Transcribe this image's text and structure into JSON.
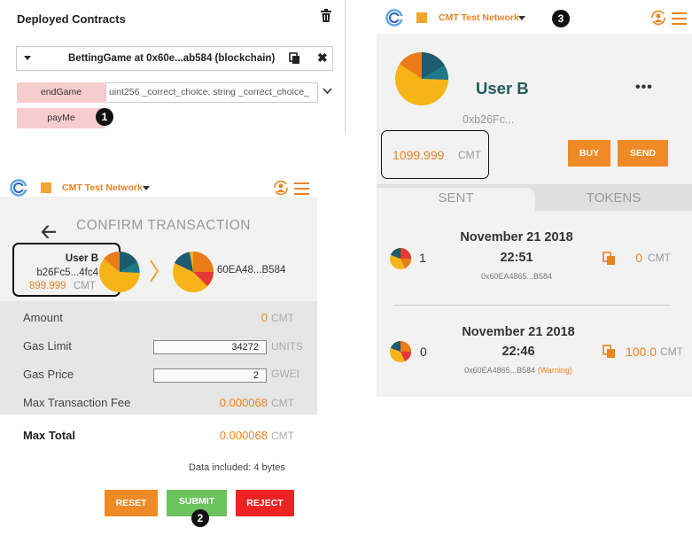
{
  "panel1": {
    "title": "Deployed Contracts",
    "contract_label": "BettingGame at 0x60e...ab584 (blockchain)",
    "close_symbol": "✖",
    "functions": [
      {
        "label": "endGame"
      },
      {
        "label": "payMe"
      }
    ],
    "endgame_params": "uint256 _correct_choice, string _correct_choice_",
    "badge": "1"
  },
  "panel2": {
    "network": "CMT Test Network",
    "title": "CONFIRM TRANSACTION",
    "back_symbol": "🡠",
    "sender": {
      "name": "User B",
      "address": "b26Fc5...4fc4",
      "balance": "899.999",
      "currency": "CMT"
    },
    "recipient": {
      "address": "60EA48...B584"
    },
    "rows": {
      "amount": {
        "label": "Amount",
        "value": "0",
        "unit": "CMT"
      },
      "gas_limit": {
        "label": "Gas Limit",
        "value": "34272",
        "unit": "UNITS"
      },
      "gas_price": {
        "label": "Gas Price",
        "value": "2",
        "unit": "GWEI"
      },
      "max_fee": {
        "label": "Max Transaction Fee",
        "value": "0.000068",
        "unit": "CMT"
      },
      "max_total": {
        "label": "Max Total",
        "value": "0.000068",
        "unit": "CMT"
      }
    },
    "data_included": "Data included: 4 bytes",
    "buttons": {
      "reset": "RESET",
      "submit": "SUBMIT",
      "reject": "REJECT"
    },
    "badge": "2",
    "colors": {
      "reset": "#f08a24",
      "submit": "#6cc25f",
      "reject": "#ee2424"
    }
  },
  "panel3": {
    "network": "CMT Test Network",
    "badge": "3",
    "user_name": "User B",
    "more_symbol": "•••",
    "short_address": "0xb26Fc...",
    "balance": "1099.999",
    "currency": "CMT",
    "buttons": {
      "buy": "BUY",
      "send": "SEND"
    },
    "tabs": {
      "sent": "SENT",
      "tokens": "TOKENS"
    },
    "transactions": [
      {
        "nonce": "1",
        "date": "November 21 2018",
        "time": "22:51",
        "to": "0x60EA4865...B584",
        "warning": "",
        "amount": "0",
        "currency": "CMT"
      },
      {
        "nonce": "0",
        "date": "November 21 2018",
        "time": "22:46",
        "to": "0x60EA4865...B584",
        "warning": "(Warning)",
        "amount": "100.0",
        "currency": "CMT"
      }
    ]
  },
  "colors": {
    "accent": "#e98423",
    "network_square": "#f0a431",
    "fn_button": "#f6cccc",
    "teal": "#1f5b5b"
  }
}
